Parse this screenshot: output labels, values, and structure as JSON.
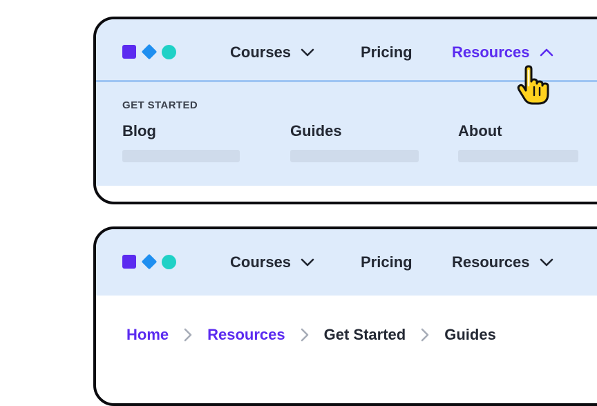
{
  "top_panel": {
    "nav": {
      "courses": "Courses",
      "pricing": "Pricing",
      "resources": "Resources"
    },
    "dropdown": {
      "section_label": "GET STARTED",
      "items": [
        {
          "title": "Blog"
        },
        {
          "title": "Guides"
        },
        {
          "title": "About"
        }
      ]
    }
  },
  "bottom_panel": {
    "nav": {
      "courses": "Courses",
      "pricing": "Pricing",
      "resources": "Resources"
    },
    "breadcrumb": [
      "Home",
      "Resources",
      "Get Started",
      "Guides"
    ]
  },
  "colors": {
    "accent": "#5b2bf0",
    "nav_bg": "#deebfb",
    "logo_square": "#5b2bf0",
    "logo_diamond": "#1f8ff0",
    "logo_circle": "#1fd1c6",
    "cursor": "#ffd21f"
  },
  "icons": {
    "dropdown_open": "chevron-up-icon",
    "dropdown_closed": "chevron-down-icon",
    "breadcrumb_separator": "chevron-right-icon",
    "pointer": "hand-pointer-icon"
  }
}
